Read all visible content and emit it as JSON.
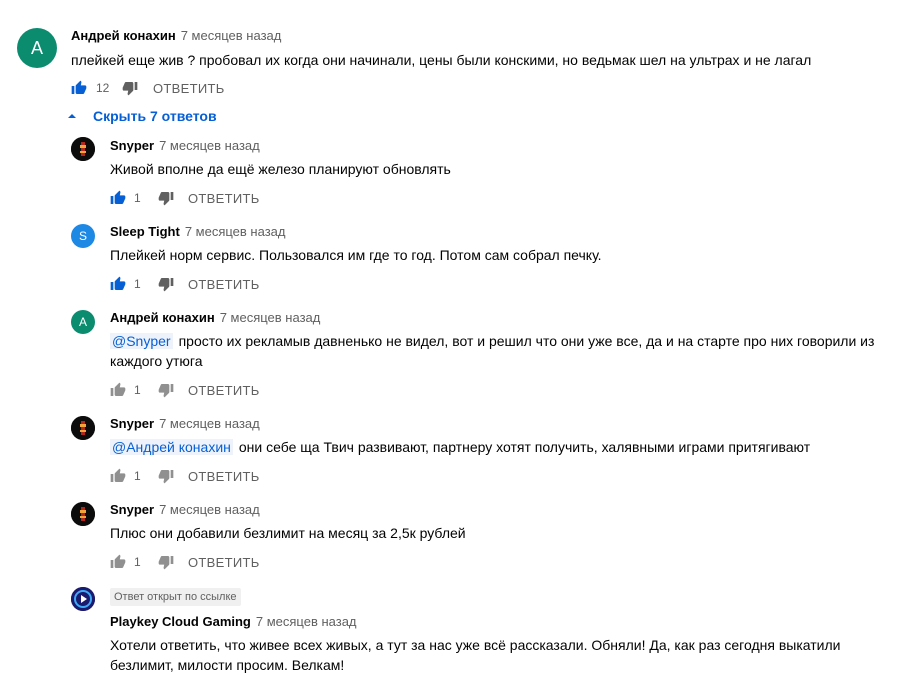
{
  "top_comment": {
    "avatar_letter": "А",
    "avatar_color": "#0b8c6f",
    "author": "Андрей конахин",
    "time": "7 месяцев назад",
    "text": "плейкей еще жив ? пробовал их когда они начинали, цены были конскими, но ведьмак шел на ультрах и не лагал",
    "likes": "12",
    "reply_label": "ОТВЕТИТЬ"
  },
  "replies_toggle": {
    "label": "Скрыть 7 ответов"
  },
  "replies": [
    {
      "author": "Snyper",
      "time": "7 месяцев назад",
      "mention": "",
      "text": "Живой вполне да ещё железо планируют обновлять",
      "likes": "1",
      "reply_label": "ОТВЕТИТЬ",
      "liked": true
    },
    {
      "author": "Sleep Tight",
      "time": "7 месяцев назад",
      "avatar_letter": "S",
      "avatar_color": "#1e88e5",
      "mention": "",
      "text": "Плейкей норм сервис. Пользовался им где то год. Потом сам собрал печку.",
      "likes": "1",
      "reply_label": "ОТВЕТИТЬ",
      "liked": true
    },
    {
      "author": "Андрей конахин",
      "time": "7 месяцев назад",
      "avatar_letter": "А",
      "avatar_color": "#0b8c6f",
      "mention": "@Snyper",
      "text_line1": "просто их рекламыв давненько не видел, вот и решил что они уже все, да и на старте про них говорили из",
      "text_line2": "каждого утюга",
      "likes": "1",
      "reply_label": "ОТВЕТИТЬ",
      "liked": false
    },
    {
      "author": "Snyper",
      "time": "7 месяцев назад",
      "mention": "@Андрей конахин",
      "text": "они себе ща Твич развивают, партнеру хотят получить, халявными играми притягивают",
      "likes": "1",
      "reply_label": "ОТВЕТИТЬ",
      "liked": false
    },
    {
      "author": "Snyper",
      "time": "7 месяцев назад",
      "mention": "",
      "text": "Плюс они добавили безлимит на месяц за 2,5к рублей",
      "likes": "1",
      "reply_label": "ОТВЕТИТЬ",
      "liked": false
    },
    {
      "badge": "Ответ открыт по ссылке",
      "author": "Playkey Cloud Gaming",
      "time": "7 месяцев назад",
      "text_line1": "Хотели ответить, что живее всех живых, а тут за нас уже всё рассказали. Обняли! Да, как раз сегодня выкатили",
      "text_line2": "безлимит, милости просим. Велкам!"
    }
  ],
  "colors": {
    "link_blue": "#065fd4",
    "secondary_text": "#606060"
  }
}
